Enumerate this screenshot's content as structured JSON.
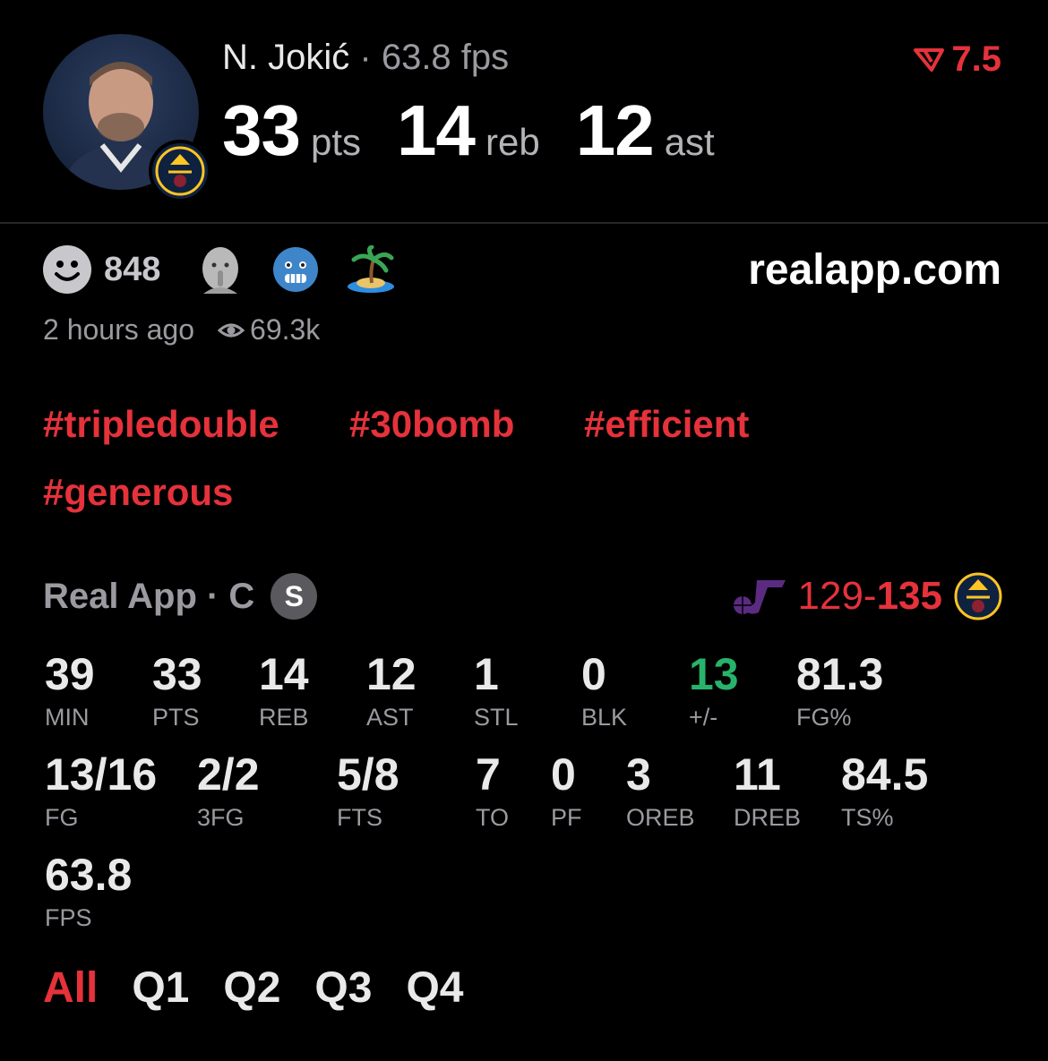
{
  "player": {
    "name": "N. Jokić",
    "separator": "·",
    "fps_label": "63.8 fps",
    "headline_stats": [
      {
        "value": "33",
        "unit": "pts"
      },
      {
        "value": "14",
        "unit": "reb"
      },
      {
        "value": "12",
        "unit": "ast"
      }
    ],
    "rating": "7.5"
  },
  "reactions": {
    "count": "848",
    "emojis": [
      "shushing-face-emoji",
      "cold-face-emoji",
      "island-emoji"
    ]
  },
  "site": "realapp.com",
  "meta": {
    "time": "2 hours ago",
    "views": "69.3k"
  },
  "tags": [
    "#tripledouble",
    "#30bomb",
    "#efficient",
    "#generous"
  ],
  "game": {
    "source": "Real App · C",
    "badge": "S",
    "away_score": "129-",
    "home_score": "135"
  },
  "stats": [
    {
      "value": "39",
      "label": "MIN"
    },
    {
      "value": "33",
      "label": "PTS"
    },
    {
      "value": "14",
      "label": "REB"
    },
    {
      "value": "12",
      "label": "AST"
    },
    {
      "value": "1",
      "label": "STL"
    },
    {
      "value": "0",
      "label": "BLK"
    },
    {
      "value": "13",
      "label": "+/-"
    },
    {
      "value": "81.3",
      "label": "FG%"
    },
    {
      "value": "13/16",
      "label": "FG"
    },
    {
      "value": "2/2",
      "label": "3FG"
    },
    {
      "value": "5/8",
      "label": "FTS"
    },
    {
      "value": "7",
      "label": "TO"
    },
    {
      "value": "0",
      "label": "PF"
    },
    {
      "value": "3",
      "label": "OREB"
    },
    {
      "value": "11",
      "label": "DREB"
    },
    {
      "value": "84.5",
      "label": "TS%"
    },
    {
      "value": "63.8",
      "label": "FPS"
    }
  ],
  "quarters": [
    "All",
    "Q1",
    "Q2",
    "Q3",
    "Q4"
  ],
  "colors": {
    "accent": "#e5323b",
    "positive": "#27b36a",
    "background": "#000000"
  }
}
